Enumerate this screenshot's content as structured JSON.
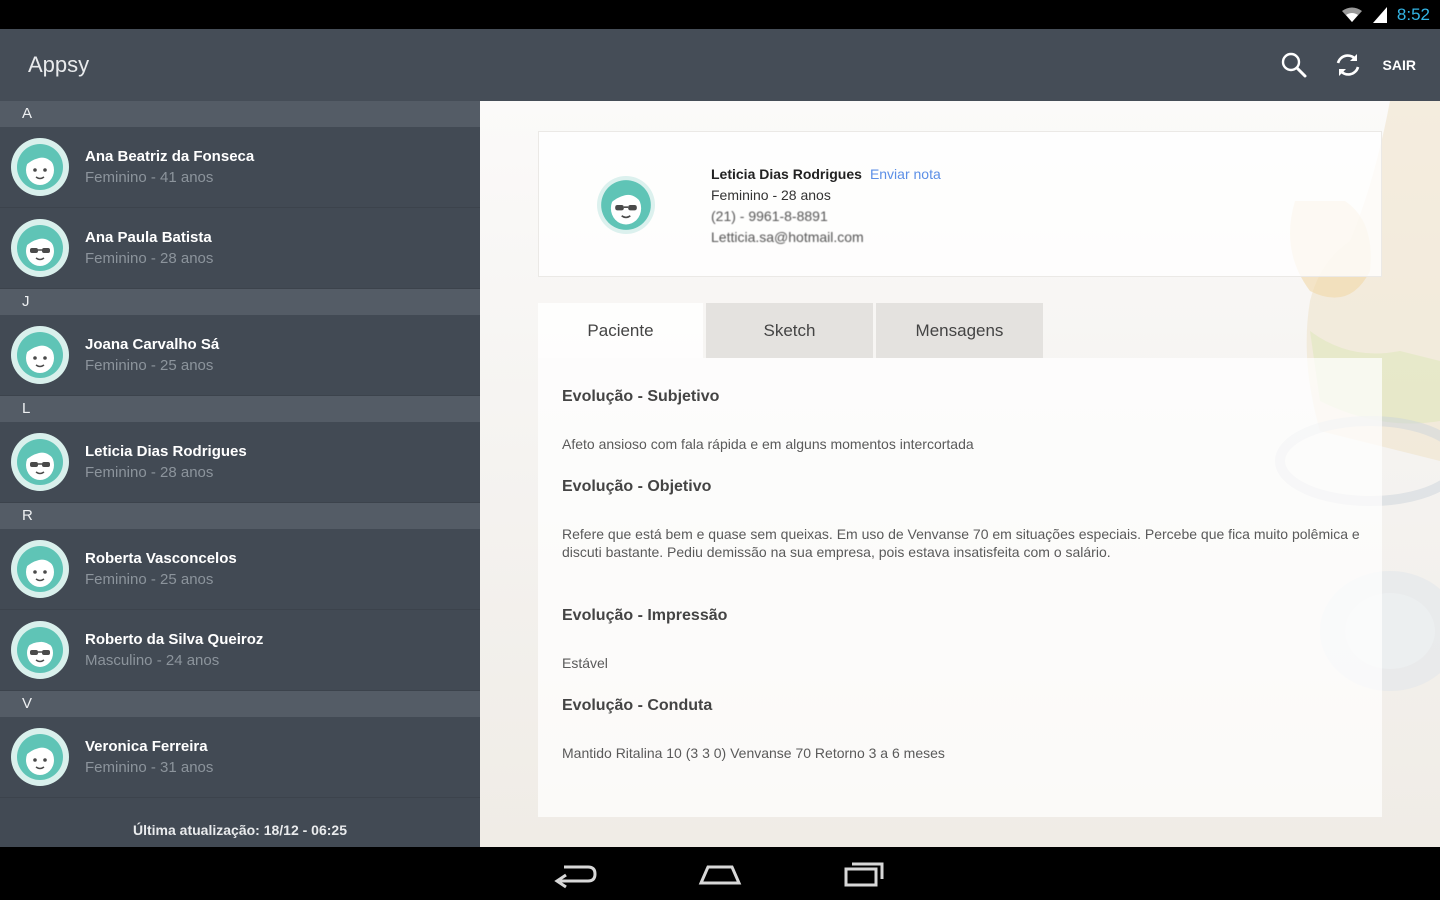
{
  "status_bar": {
    "time": "8:52"
  },
  "app": {
    "title": "Appsy",
    "logout_label": "SAIR"
  },
  "sidebar": {
    "groups": [
      {
        "letter": "A",
        "contacts": [
          {
            "name": "Ana Beatriz da Fonseca",
            "detail": "Feminino - 41 anos"
          },
          {
            "name": "Ana Paula Batista",
            "detail": "Feminino - 28 anos"
          }
        ]
      },
      {
        "letter": "J",
        "contacts": [
          {
            "name": "Joana Carvalho Sá",
            "detail": "Feminino - 25 anos"
          }
        ]
      },
      {
        "letter": "L",
        "contacts": [
          {
            "name": "Leticia Dias Rodrigues",
            "detail": "Feminino - 28 anos"
          }
        ]
      },
      {
        "letter": "R",
        "contacts": [
          {
            "name": "Roberta Vasconcelos",
            "detail": "Feminino - 25 anos"
          },
          {
            "name": "Roberto da Silva Queiroz",
            "detail": "Masculino - 24 anos"
          }
        ]
      },
      {
        "letter": "V",
        "contacts": [
          {
            "name": "Veronica Ferreira",
            "detail": "Feminino - 31 anos"
          }
        ]
      }
    ],
    "last_update": "Última atualização: 18/12 - 06:25"
  },
  "patient": {
    "name": "Leticia Dias Rodrigues",
    "send_note": "Enviar nota",
    "detail": "Feminino - 28 anos",
    "phone": "(21) - 9961-8-8891",
    "email": "Letticia.sa@hotmail.com"
  },
  "tabs": [
    "Paciente",
    "Sketch",
    "Mensagens"
  ],
  "sections": [
    {
      "title": "Evolução - Subjetivo",
      "text": "Afeto ansioso com fala rápida e em alguns momentos intercortada"
    },
    {
      "title": "Evolução - Objetivo",
      "text": "Refere que está bem e quase sem queixas. Em uso de Venvanse 70 em situações especiais. Percebe que fica muito polêmica e discuti bastante. Pediu demissão na sua empresa, pois estava insatisfeita com o salário."
    },
    {
      "title": "Evolução - Impressão",
      "text": "Estável"
    },
    {
      "title": "Evolução - Conduta",
      "text": "Mantido Ritalina 10 (3 3 0) Venvanse 70 Retorno 3 a 6 meses"
    }
  ],
  "colors": {
    "action_bar": "#454d57",
    "sidebar": "#424a54",
    "section_header": "#545c66",
    "accent_link": "#5c8fe6",
    "avatar_teal": "#5fc4b6"
  },
  "icons": [
    "wifi-icon",
    "signal-icon",
    "search-icon",
    "refresh-icon",
    "back-icon",
    "home-icon",
    "recent-apps-icon",
    "female-avatar-icon",
    "male-avatar-icon"
  ]
}
